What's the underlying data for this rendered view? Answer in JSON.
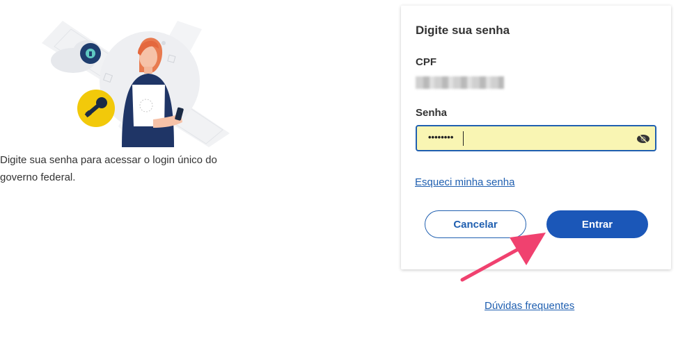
{
  "intro": {
    "text": "Digite sua senha para acessar o login único do governo federal."
  },
  "card": {
    "title": "Digite sua senha",
    "cpf_label": "CPF",
    "cpf_value": "•••.•••.•••-••",
    "senha_label": "Senha",
    "password_value": "••••••••",
    "forgot_link": "Esqueci minha senha",
    "cancel_label": "Cancelar",
    "enter_label": "Entrar"
  },
  "footer": {
    "faq_link": "Dúvidas frequentes"
  },
  "icons": {
    "eye": "eye-icon",
    "key": "key-icon",
    "lock": "lock-icon",
    "arrow": "arrow-pointer"
  },
  "colors": {
    "primary": "#1b57b8",
    "field_bg": "#f9f5b3",
    "arrow": "#f0416f",
    "key_badge": "#f2c90a"
  }
}
